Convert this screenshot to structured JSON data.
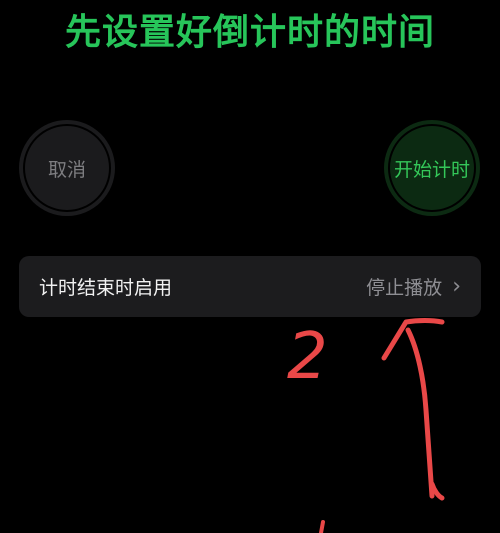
{
  "headline": "先设置好倒计时的时间",
  "buttons": {
    "cancel_label": "取消",
    "start_label": "开始计时"
  },
  "settings_row": {
    "label": "计时结束时启用",
    "value": "停止播放"
  },
  "icons": {
    "row_chevron": "chevron-right-icon"
  },
  "annotation": {
    "step_number": "2"
  },
  "colors": {
    "background": "#000000",
    "headline": "#27c55a",
    "cancel_bg": "#1b1b1d",
    "cancel_text": "#7d7d80",
    "start_bg": "#0c2a12",
    "start_text": "#34c759",
    "row_bg": "#1c1c1e",
    "row_label": "#f2f2f2",
    "row_value": "#8e8e93",
    "annotation": "#e94848"
  }
}
